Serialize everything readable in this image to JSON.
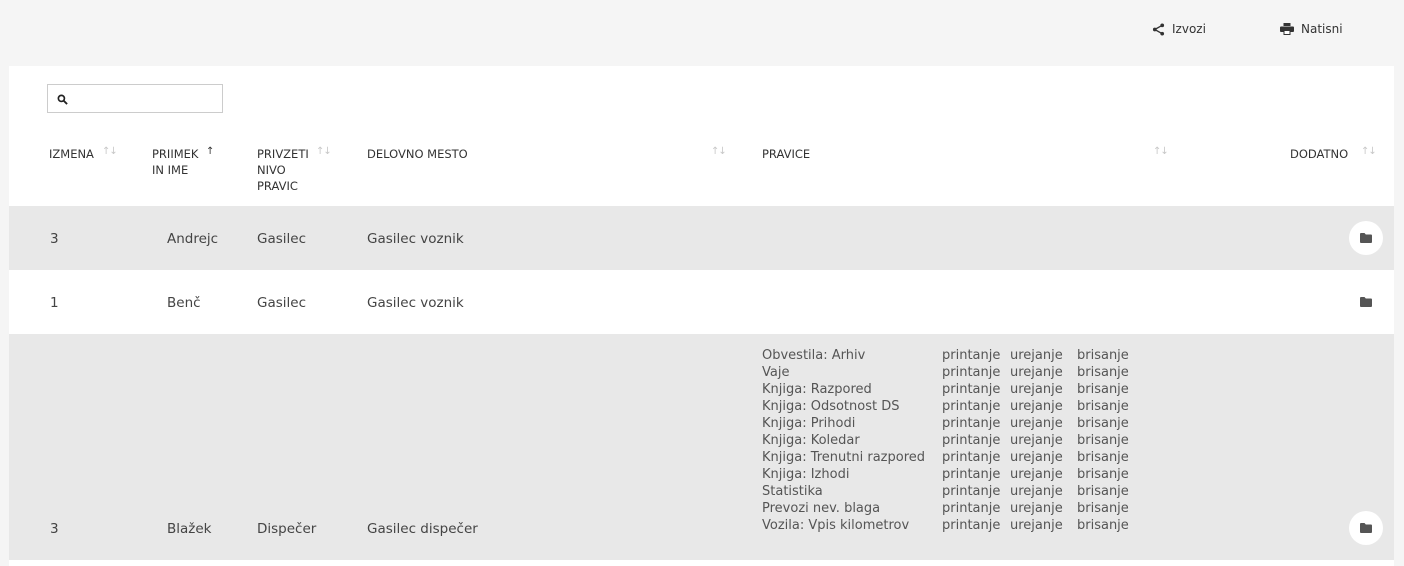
{
  "toolbar": {
    "export_label": "Izvozi",
    "print_label": "Natisni"
  },
  "search": {
    "placeholder": ""
  },
  "table": {
    "headers": {
      "izmena": "IZMENA",
      "priimek_line1": "PRIIMEK",
      "priimek_line2": "IN IME",
      "nivo_line1": "PRIVZETI",
      "nivo_line2": "NIVO",
      "nivo_line3": "PRAVIC",
      "delovno": "DELOVNO MESTO",
      "pravice": "PRAVICE",
      "dodatno": "DODATNO"
    },
    "rows": [
      {
        "izmena": "3",
        "name": "Andrejc",
        "nivo": "Gasilec",
        "mesto": "Gasilec voznik"
      },
      {
        "izmena": "1",
        "name": "Benč",
        "nivo": "Gasilec",
        "mesto": "Gasilec voznik"
      },
      {
        "izmena": "3",
        "name": "Blažek",
        "nivo": "Dispečer",
        "mesto": "Gasilec dispečer",
        "permissions": [
          {
            "name": "Obvestila: Arhiv",
            "a": "printanje",
            "b": "urejanje",
            "c": "brisanje"
          },
          {
            "name": "Vaje",
            "a": "printanje",
            "b": "urejanje",
            "c": "brisanje"
          },
          {
            "name": "Knjiga: Razpored",
            "a": "printanje",
            "b": "urejanje",
            "c": "brisanje"
          },
          {
            "name": "Knjiga: Odsotnost DS",
            "a": "printanje",
            "b": "urejanje",
            "c": "brisanje"
          },
          {
            "name": "Knjiga: Prihodi",
            "a": "printanje",
            "b": "urejanje",
            "c": "brisanje"
          },
          {
            "name": "Knjiga: Koledar",
            "a": "printanje",
            "b": "urejanje",
            "c": "brisanje"
          },
          {
            "name": "Knjiga: Trenutni razpored",
            "a": "printanje",
            "b": "urejanje",
            "c": "brisanje"
          },
          {
            "name": "Knjiga: Izhodi",
            "a": "printanje",
            "b": "urejanje",
            "c": "brisanje"
          },
          {
            "name": "Statistika",
            "a": "printanje",
            "b": "urejanje",
            "c": "brisanje"
          },
          {
            "name": "Prevozi nev. blaga",
            "a": "printanje",
            "b": "urejanje",
            "c": "brisanje"
          },
          {
            "name": "Vozila: Vpis kilometrov",
            "a": "printanje",
            "b": "urejanje",
            "c": "brisanje"
          }
        ]
      }
    ]
  },
  "icons": {
    "export": "share-icon",
    "print": "printer-icon",
    "search": "search-icon",
    "folder": "folder-icon",
    "sort": "sort-arrows-icon"
  },
  "colors": {
    "row_shaded": "#e8e8e8",
    "background": "#f5f5f5"
  }
}
